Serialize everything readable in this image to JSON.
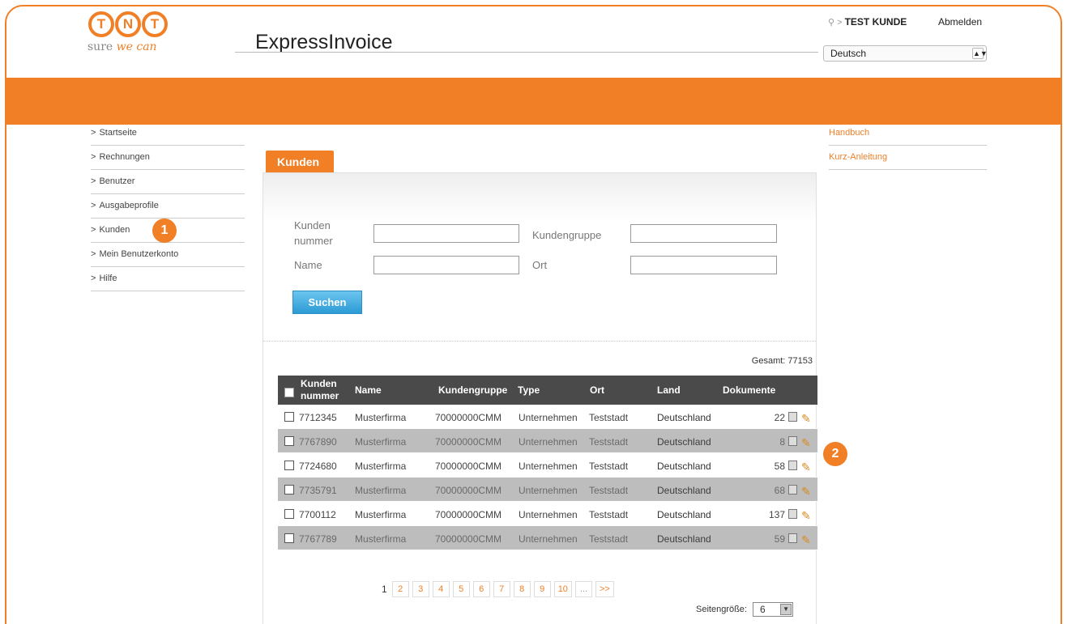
{
  "header": {
    "logo_letters": [
      "T",
      "N",
      "T"
    ],
    "tagline_plain": "sure",
    "tagline_em": "we can",
    "app_title": "ExpressInvoice",
    "user_name": "TEST KUNDE",
    "logout_label": "Abmelden",
    "language": "Deutsch"
  },
  "nav": {
    "items": [
      "Startseite",
      "Rechnungen",
      "Benutzer",
      "Ausgabeprofile",
      "Kunden",
      "Mein Benutzerkonto",
      "Hilfe"
    ]
  },
  "side_links": [
    "Handbuch",
    "Kurz-Anleitung"
  ],
  "markers": [
    "1",
    "2"
  ],
  "tab_label": "Kunden",
  "form": {
    "label_kundennummer_1": "Kunden",
    "label_kundennummer_2": "nummer",
    "label_kundengruppe": "Kundengruppe",
    "label_name": "Name",
    "label_ort": "Ort",
    "search_button": "Suchen"
  },
  "total": "Gesamt: 77153",
  "table": {
    "headers": {
      "kundennummer_1": "Kunden",
      "kundennummer_2": "nummer",
      "name": "Name",
      "kundengruppe": "Kundengruppe",
      "type": "Type",
      "ort": "Ort",
      "land": "Land",
      "dokumente": "Dokumente"
    },
    "rows": [
      {
        "nr": "7712345",
        "name": "Musterfirma",
        "gruppe": "70000000CMM",
        "type": "Unternehmen",
        "ort": "Teststadt",
        "land": "Deutschland",
        "docs": "22"
      },
      {
        "nr": "7767890",
        "name": "Musterfirma",
        "gruppe": "70000000CMM",
        "type": "Unternehmen",
        "ort": "Teststadt",
        "land": "Deutschland",
        "docs": "8"
      },
      {
        "nr": "7724680",
        "name": "Musterfirma",
        "gruppe": "70000000CMM",
        "type": "Unternehmen",
        "ort": "Teststadt",
        "land": "Deutschland",
        "docs": "58"
      },
      {
        "nr": "7735791",
        "name": "Musterfirma",
        "gruppe": "70000000CMM",
        "type": "Unternehmen",
        "ort": "Teststadt",
        "land": "Deutschland",
        "docs": "68"
      },
      {
        "nr": "7700112",
        "name": "Musterfirma",
        "gruppe": "70000000CMM",
        "type": "Unternehmen",
        "ort": "Teststadt",
        "land": "Deutschland",
        "docs": "137"
      },
      {
        "nr": "7767789",
        "name": "Musterfirma",
        "gruppe": "70000000CMM",
        "type": "Unternehmen",
        "ort": "Teststadt",
        "land": "Deutschland",
        "docs": "59"
      }
    ]
  },
  "pagination": {
    "current": "1",
    "pages": [
      "2",
      "3",
      "4",
      "5",
      "6",
      "7",
      "8",
      "9",
      "10"
    ],
    "ellipsis": "...",
    "next": ">>",
    "page_size_label": "Seitengröße:",
    "page_size_value": "6"
  },
  "colors": {
    "accent": "#f07f26",
    "button": "#2c9bd5",
    "table_header": "#4a4a4a",
    "row_alt": "#bdbdbd"
  }
}
